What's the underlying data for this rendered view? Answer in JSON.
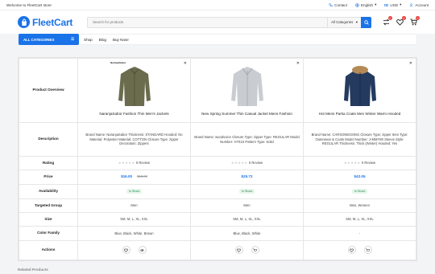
{
  "topbar": {
    "welcome": "Welcome to FleetCart store",
    "contact": "Contact",
    "language": "English",
    "currency": "USD",
    "account": "Account"
  },
  "header": {
    "brand": "FleetCart",
    "search_placeholder": "Search for products",
    "category_select": "All Categories",
    "cart_count": "0",
    "wishlist_count": "0",
    "compare_count": "0",
    "brand_color": "#1a73e8"
  },
  "nav": {
    "all_categories": "ALL CATEGORIES",
    "links": [
      "Shop",
      "Blog",
      "Buy Now!"
    ]
  },
  "compare": {
    "row_labels": {
      "overview": "Product Overview",
      "description": "Description",
      "rating": "Rating",
      "price": "Price",
      "availability": "Availability",
      "group": "Targeted Group",
      "size": "Size",
      "color": "Color Family",
      "actions": "Actions"
    },
    "products": [
      {
        "brand_tag": "NaranjaSabor",
        "name": "NaranjaSabor Fashion Thin Men's Jackets",
        "description": "Brand Name: NaranjaSabor Thickness: STANDARD Hooded: No Material: Polyester Material: COTTON Closure Type: zipper Decoration: Zippers",
        "rating_text": "0 Review",
        "price": "$16.00",
        "old_price": "$18.00",
        "stock": "In Stock",
        "group": "Men",
        "size": "SM, M, L, XL, XXL",
        "color": "Blue, Black, White, Brown",
        "image_color": "#6b6b4e"
      },
      {
        "brand_tag": "",
        "name": "New Spring Summer Thin Casual Jacket Mens Fashion",
        "description": "Brand Name: woodvoice Closure Type: zipper Type: REGULAR Model Number: H701S Pattern Type: Solid",
        "rating_text": "0 Review",
        "price": "$25.72",
        "old_price": "",
        "stock": "In Stock",
        "group": "Men",
        "size": "SM, M, L, XL, XXL",
        "color": "Blue, Black, White",
        "image_color": "#c9ccd1"
      },
      {
        "brand_tag": "",
        "name": "Hot Mens Parka Coats Men Winter Warm Hooded",
        "description": "Brand Name: CARSONESSING Closure Type: zipper Item Type: Outerwear & Coats Model Number: J-MMY80 Sleeve Style: REGULAR Thickness: Thick (Winter) Hooded: Yes",
        "rating_text": "0 Review",
        "price": "$42.05",
        "old_price": "",
        "stock": "In Stock",
        "group": "Men, Women",
        "size": "SM, M, L, XL, XXL",
        "color": "-",
        "image_color": "#243a5e"
      }
    ]
  },
  "below_title": "Related Products"
}
